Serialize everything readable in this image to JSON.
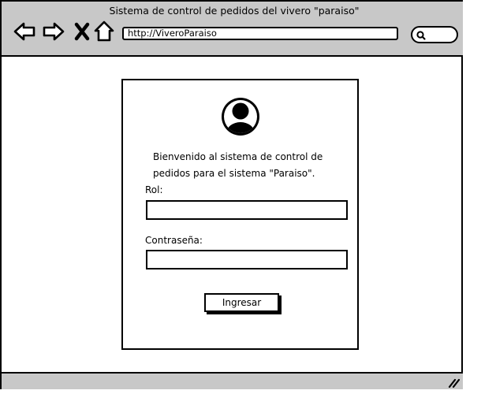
{
  "browser": {
    "title": "Sistema de control de pedidos del vivero \"paraiso\"",
    "url": "http://ViveroParaiso",
    "icons": {
      "back": "back-arrow-icon",
      "forward": "forward-arrow-icon",
      "stop": "close-icon",
      "home": "home-icon",
      "search": "search-icon",
      "resize": "resize-grip-icon"
    }
  },
  "login": {
    "avatar_icon": "user-avatar-icon",
    "welcome": "Bienvenido al sistema de control de pedidos para el sistema \"Paraiso\".",
    "role_label": "Rol:",
    "role_value": "",
    "password_label": "Contraseña:",
    "password_value": "",
    "submit_label": "Ingresar"
  }
}
